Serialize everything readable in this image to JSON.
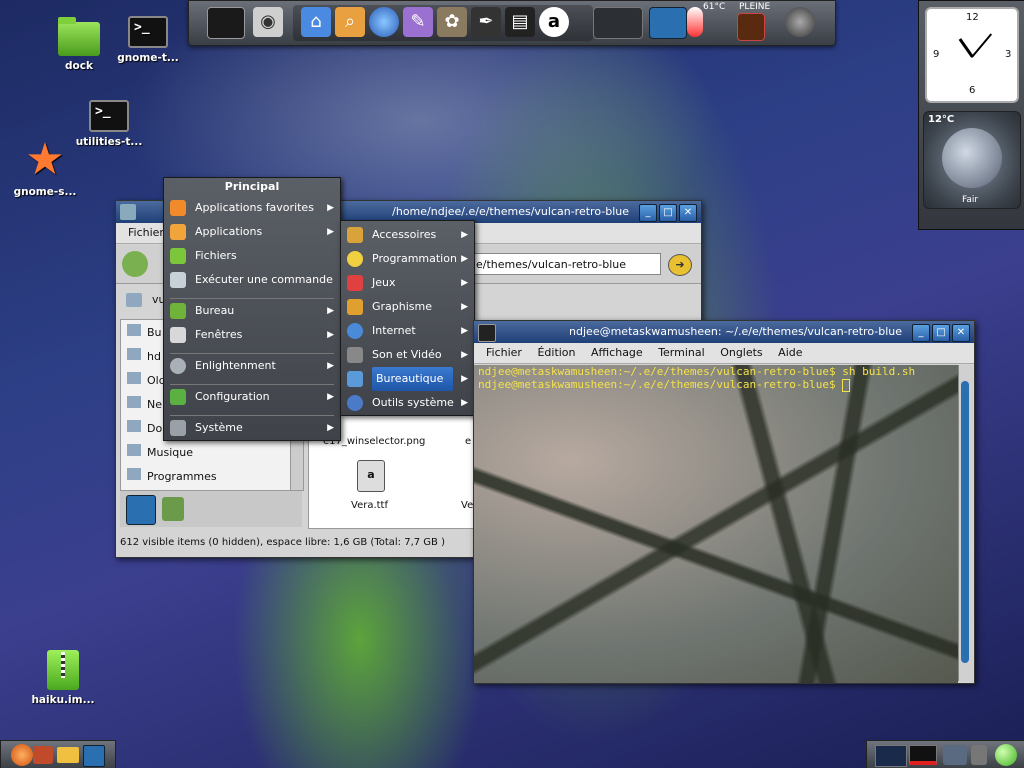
{
  "desktop_icons": [
    {
      "label": "dock",
      "kind": "folder"
    },
    {
      "label": "gnome-t...",
      "kind": "terminal"
    },
    {
      "label": "utilities-t...",
      "kind": "terminal"
    },
    {
      "label": "gnome-s...",
      "kind": "star"
    },
    {
      "label": "haiku.im...",
      "kind": "archive"
    }
  ],
  "dock": {
    "temperature_cpu": "61°C",
    "battery_label": "PLEINE",
    "items": [
      "monitor-icon",
      "camera-icon",
      "home-folder-icon",
      "search-folder-icon",
      "globe-icon",
      "pidgin-icon",
      "gimp-icon",
      "inkscape-icon",
      "video-icon",
      "amarok-icon",
      "desk-switcher-icon",
      "thermometer-icon",
      "battery-icon",
      "volume-icon"
    ]
  },
  "clock": {
    "numbers": [
      "12",
      "3",
      "6",
      "9"
    ]
  },
  "weather": {
    "temp": "12°C",
    "condition": "Fair"
  },
  "file_manager": {
    "title": "/home/ndjee/.e/e/themes/vulcan-retro-blue",
    "menu": [
      "Fichier"
    ],
    "path_field": "e/themes/vulcan-retro-blue",
    "crumb": "vul",
    "sidebar": [
      "Bu",
      "hd",
      "Old",
      "Ne",
      "Do",
      "Musique",
      "Programmes"
    ],
    "files": [
      {
        "name": "e17_winselector.png"
      },
      {
        "name": "e"
      },
      {
        "name": "Vera.ttf"
      },
      {
        "name": "Ve"
      }
    ],
    "status": "612 visible items (0 hidden), espace libre: 1,6 GB (Total: 7,7 GB )"
  },
  "main_menu": {
    "title": "Principal",
    "items": [
      {
        "label": "Applications favorites",
        "arrow": true,
        "color": "#f08a2a"
      },
      {
        "label": "Applications",
        "arrow": true,
        "color": "#f0a43a"
      },
      {
        "label": "Fichiers",
        "arrow": false,
        "color": "#7bc63a"
      },
      {
        "label": "Exécuter une commande",
        "arrow": false,
        "color": "#c8d0d8"
      },
      {
        "label": "Bureau",
        "arrow": true,
        "color": "#6fb33a"
      },
      {
        "label": "Fenêtres",
        "arrow": true,
        "color": "#d8d8d8"
      },
      {
        "label": "Enlightenment",
        "arrow": true,
        "color": "#aab0b8"
      },
      {
        "label": "Configuration",
        "arrow": true,
        "color": "#5ab040"
      },
      {
        "label": "Système",
        "arrow": true,
        "color": "#9aa0a8"
      }
    ]
  },
  "apps_menu": {
    "items": [
      {
        "label": "Accessoires",
        "color": "#d9a23a"
      },
      {
        "label": "Programmation",
        "color": "#f0d040"
      },
      {
        "label": "Jeux",
        "color": "#e04040"
      },
      {
        "label": "Graphisme",
        "color": "#e0a030"
      },
      {
        "label": "Internet",
        "color": "#4a8ad8"
      },
      {
        "label": "Son et Vidéo",
        "color": "#888888"
      },
      {
        "label": "Bureautique",
        "color": "#5a9ad8",
        "selected": true
      },
      {
        "label": "Outils système",
        "color": "#4a7ac8"
      }
    ]
  },
  "terminal": {
    "title": "ndjee@metaskwamusheen: ~/.e/e/themes/vulcan-retro-blue",
    "menu": [
      "Fichier",
      "Édition",
      "Affichage",
      "Terminal",
      "Onglets",
      "Aide"
    ],
    "lines": [
      "ndjee@metaskwamusheen:~/.e/e/themes/vulcan-retro-blue$ sh build.sh",
      "ndjee@metaskwamusheen:~/.e/e/themes/vulcan-retro-blue$ "
    ]
  }
}
